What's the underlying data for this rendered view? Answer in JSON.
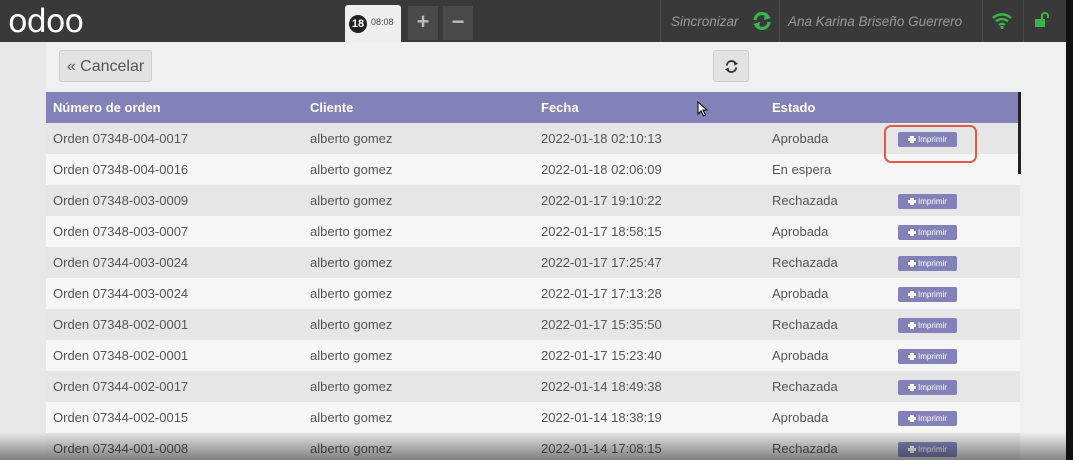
{
  "topbar": {
    "logo": "odoo",
    "order_tab": {
      "number": "18",
      "time": "08:08"
    },
    "add_label": "+",
    "remove_label": "−",
    "sync_label": "Sincronizar",
    "user_label": "Ana Karina Briseño Guerrero"
  },
  "toolbar": {
    "cancel_label": "« Cancelar"
  },
  "table": {
    "headers": [
      "Número de orden",
      "Cliente",
      "Fecha",
      "Estado",
      ""
    ],
    "print_label": "Imprimir",
    "rows": [
      {
        "order": "Orden 07348-004-0017",
        "client": "alberto gomez",
        "date": "2022-01-18 02:10:13",
        "status": "Aprobada",
        "print": "Imprimir"
      },
      {
        "order": "Orden 07348-004-0016",
        "client": "alberto gomez",
        "date": "2022-01-18 02:06:09",
        "status": "En espera",
        "print": ""
      },
      {
        "order": "Orden 07348-003-0009",
        "client": "alberto gomez",
        "date": "2022-01-17 19:10:22",
        "status": "Rechazada",
        "print": "Imprimir"
      },
      {
        "order": "Orden 07348-003-0007",
        "client": "alberto gomez",
        "date": "2022-01-17 18:58:15",
        "status": "Aprobada",
        "print": "Imprimir"
      },
      {
        "order": "Orden 07344-003-0024",
        "client": "alberto gomez",
        "date": "2022-01-17 17:25:47",
        "status": "Rechazada",
        "print": "Imprimir"
      },
      {
        "order": "Orden 07344-003-0024",
        "client": "alberto gomez",
        "date": "2022-01-17 17:13:28",
        "status": "Aprobada",
        "print": "Imprimir"
      },
      {
        "order": "Orden 07348-002-0001",
        "client": "alberto gomez",
        "date": "2022-01-17 15:35:50",
        "status": "Rechazada",
        "print": "Imprimir"
      },
      {
        "order": "Orden 07348-002-0001",
        "client": "alberto gomez",
        "date": "2022-01-17 15:23:40",
        "status": "Aprobada",
        "print": "Imprimir"
      },
      {
        "order": "Orden 07344-002-0017",
        "client": "alberto gomez",
        "date": "2022-01-14 18:49:38",
        "status": "Rechazada",
        "print": "Imprimir"
      },
      {
        "order": "Orden 07344-002-0015",
        "client": "alberto gomez",
        "date": "2022-01-14 18:38:19",
        "status": "Aprobada",
        "print": "Imprimir"
      },
      {
        "order": "Orden 07344-001-0008",
        "client": "alberto gomez",
        "date": "2022-01-14 17:08:15",
        "status": "Rechazada",
        "print": "Imprimir"
      }
    ]
  },
  "colors": {
    "header_bg": "#8282b8",
    "topbar_bg": "#393939",
    "sync_green": "#3cb44b",
    "highlight": "#e05a45"
  },
  "icons": [
    "sync-icon",
    "wifi-icon",
    "unlock-icon",
    "refresh-icon",
    "print-icon",
    "cursor-icon"
  ]
}
